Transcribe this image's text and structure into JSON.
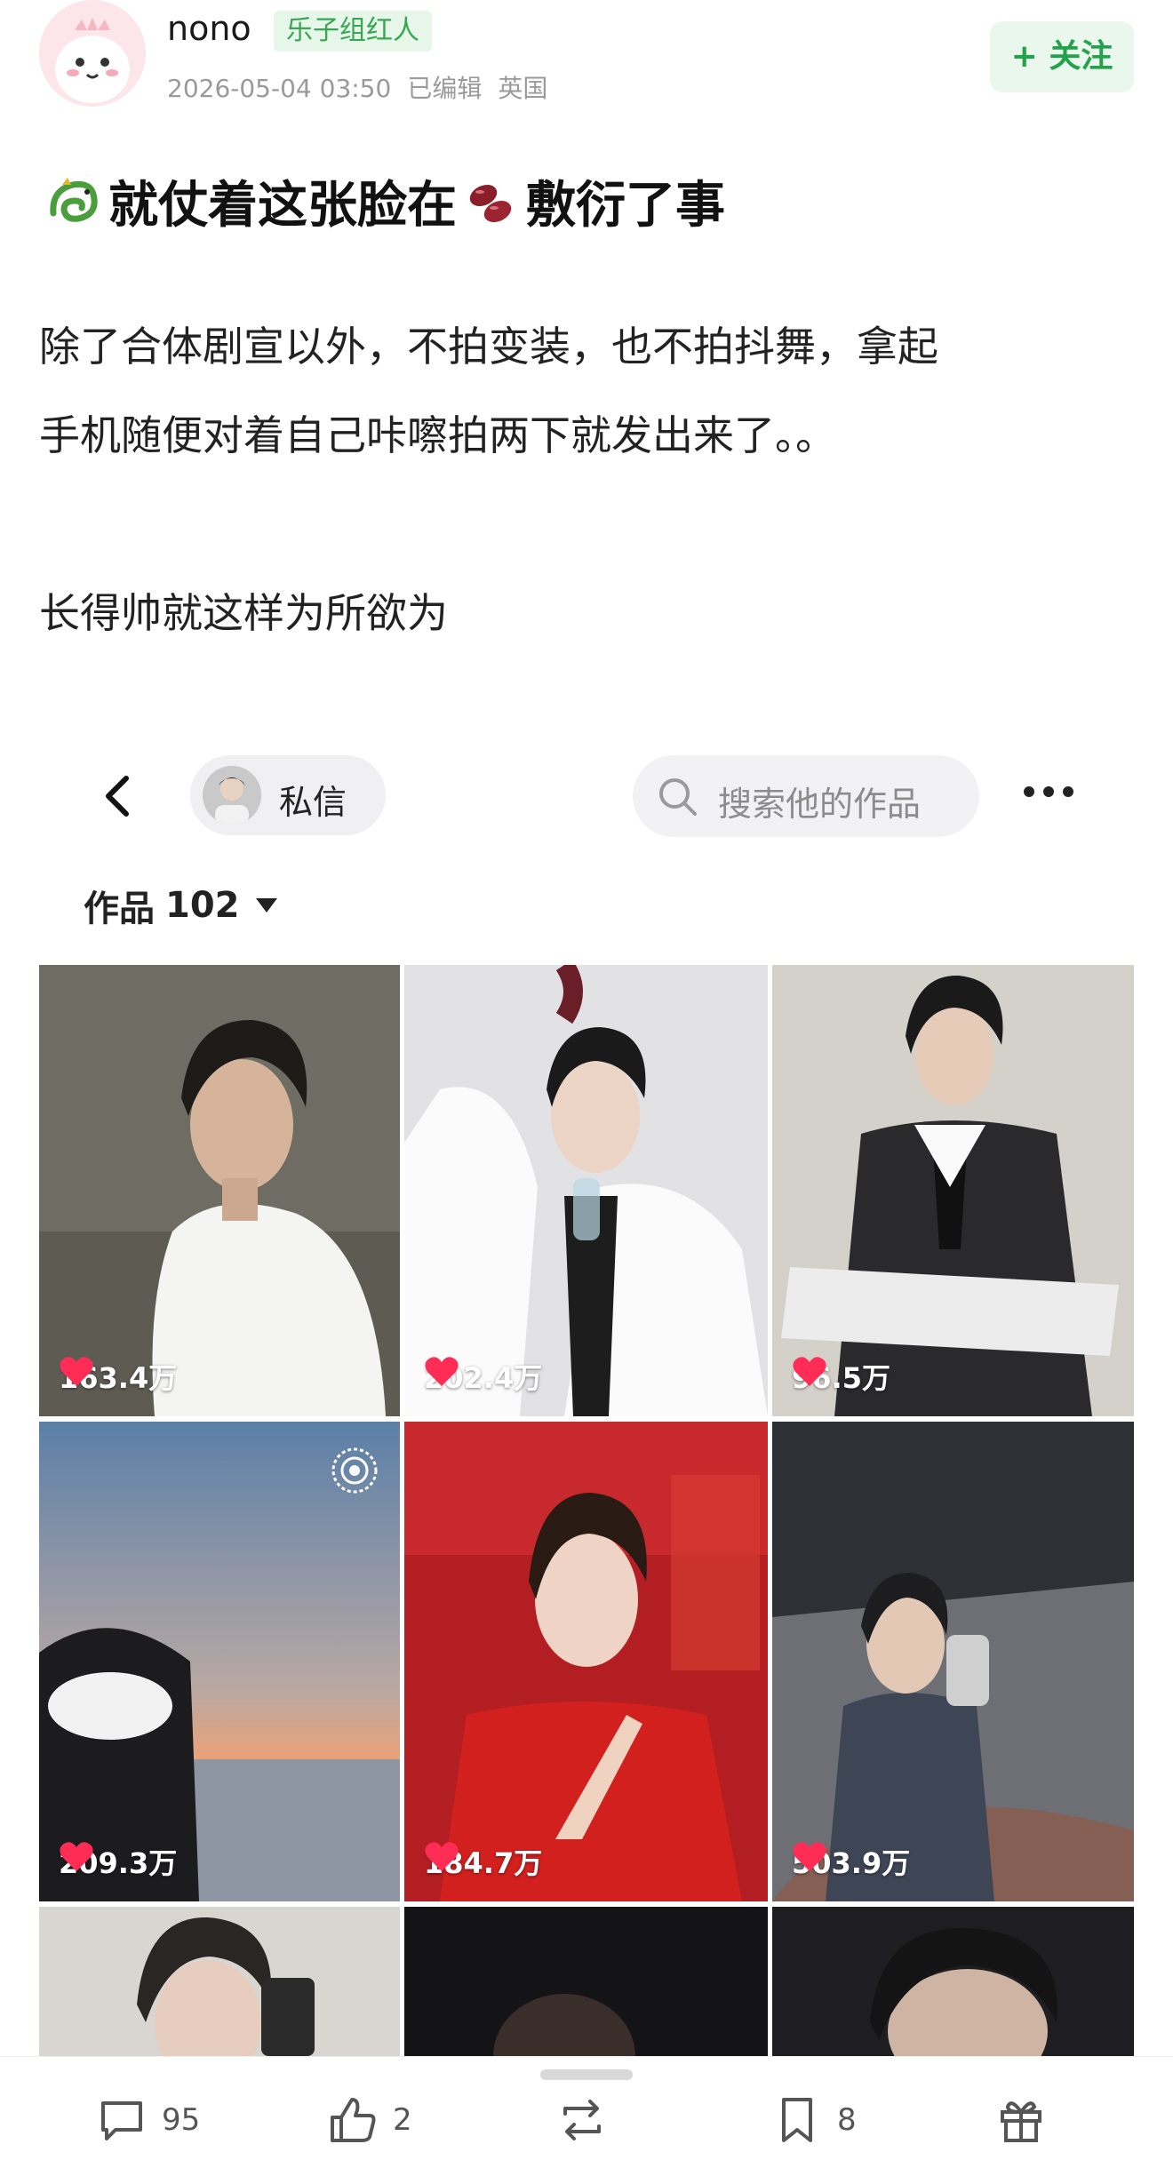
{
  "header": {
    "username": "nono",
    "badge": "乐子组红人",
    "timestamp": "2026-05-04 03:50",
    "edited": "已编辑",
    "location": "英国",
    "follow_label": "+ 关注"
  },
  "post": {
    "title": "就仗着这张脸在敷衍了事",
    "title_part1": "就仗着这张脸在",
    "title_part2": "敷衍了事",
    "paragraph1_line1": "除了合体剧宣以外，不拍变装，也不拍抖舞，拿起",
    "paragraph1_line2": "手机随便对着自己咔嚓拍两下就发出来了。。",
    "paragraph2": "长得帅就这样为所欲为"
  },
  "embedded_profile": {
    "dm_label": "私信",
    "search_placeholder": "搜索他的作品",
    "works_label": "作品",
    "works_count": "102",
    "videos": [
      {
        "likes": "163.4万"
      },
      {
        "likes": "202.4万"
      },
      {
        "likes": "96.5万"
      },
      {
        "likes": "209.3万"
      },
      {
        "likes": "184.7万"
      },
      {
        "likes": "503.9万"
      },
      {
        "likes": ""
      },
      {
        "likes": ""
      },
      {
        "likes": ""
      }
    ]
  },
  "actions": {
    "comments": "95",
    "likes": "2",
    "reposts": "",
    "bookmarks": "8"
  },
  "colors": {
    "badge_green": "#3aa655",
    "follow_green": "#23a14b",
    "heart_red": "#ff2d55"
  }
}
